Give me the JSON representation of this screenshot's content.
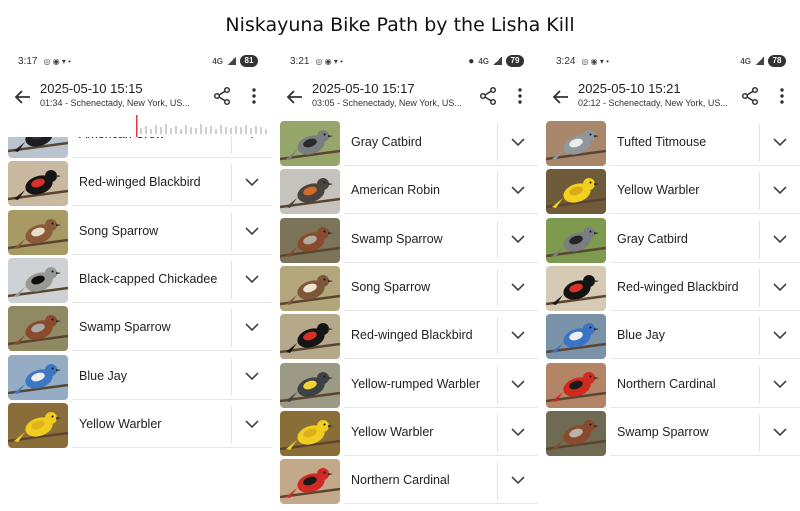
{
  "title": "Niskayuna Bike Path by the Lisha Kill",
  "screens": [
    {
      "status": {
        "time": "3:17",
        "network": "4G",
        "battery": "81"
      },
      "header": {
        "date": "2025-05-10 15:15",
        "sub": "01:34 - Schenectady, New York, US..."
      },
      "birds": [
        {
          "name": "American Crow",
          "icon": "american-crow-photo",
          "colors": [
            "#b9c4cf",
            "#1b1d22",
            "#2d3138"
          ]
        },
        {
          "name": "Red-winged Blackbird",
          "icon": "red-winged-blackbird-photo",
          "colors": [
            "#c8b9a0",
            "#151515",
            "#d8302a"
          ]
        },
        {
          "name": "Song Sparrow",
          "icon": "song-sparrow-photo",
          "colors": [
            "#a79a64",
            "#8b5a3a",
            "#e8ddc6"
          ]
        },
        {
          "name": "Black-capped Chickadee",
          "icon": "black-capped-chickadee-photo",
          "colors": [
            "#cfd2d4",
            "#9a9894",
            "#101010"
          ]
        },
        {
          "name": "Swamp Sparrow",
          "icon": "swamp-sparrow-photo",
          "colors": [
            "#8f8a63",
            "#8a4a2c",
            "#a8a8a8"
          ]
        },
        {
          "name": "Blue Jay",
          "icon": "blue-jay-photo",
          "colors": [
            "#95adc4",
            "#3d77c4",
            "#eceef0"
          ]
        },
        {
          "name": "Yellow Warbler",
          "icon": "yellow-warbler-photo",
          "colors": [
            "#8b6d3a",
            "#f0cc1e",
            "#e0b418"
          ]
        }
      ]
    },
    {
      "status": {
        "time": "3:21",
        "network": "4G",
        "battery": "79"
      },
      "header": {
        "date": "2025-05-10 15:17",
        "sub": "03:05 - Schenectady, New York, US..."
      },
      "birds": [
        {
          "name": "Gray Catbird",
          "icon": "gray-catbird-photo",
          "colors": [
            "#96a66a",
            "#7a7d80",
            "#2a2a2a"
          ]
        },
        {
          "name": "American Robin",
          "icon": "american-robin-photo",
          "colors": [
            "#c6c3bc",
            "#4a4440",
            "#d4692a"
          ]
        },
        {
          "name": "Swamp Sparrow",
          "icon": "swamp-sparrow-photo",
          "colors": [
            "#7b7458",
            "#8a4a2c",
            "#b0aca4"
          ]
        },
        {
          "name": "Song Sparrow",
          "icon": "song-sparrow-photo",
          "colors": [
            "#b3a67a",
            "#7e563a",
            "#eee3cc"
          ]
        },
        {
          "name": "Red-winged Blackbird",
          "icon": "red-winged-blackbird-photo",
          "colors": [
            "#b6a88a",
            "#141414",
            "#d62f26"
          ]
        },
        {
          "name": "Yellow-rumped Warbler",
          "icon": "yellow-rumped-warbler-photo",
          "colors": [
            "#9c9a84",
            "#3e4048",
            "#f1d330"
          ]
        },
        {
          "name": "Yellow Warbler",
          "icon": "yellow-warbler-photo",
          "colors": [
            "#8a6e38",
            "#f0cd20",
            "#dcb01a"
          ]
        },
        {
          "name": "Northern Cardinal",
          "icon": "northern-cardinal-photo",
          "colors": [
            "#c4a88a",
            "#cf2a24",
            "#1a1a1a"
          ]
        }
      ]
    },
    {
      "status": {
        "time": "3:24",
        "network": "4G",
        "battery": "78"
      },
      "header": {
        "date": "2025-05-10 15:21",
        "sub": "02:12 - Schenectady, New York, US..."
      },
      "birds": [
        {
          "name": "Tufted Titmouse",
          "icon": "tufted-titmouse-photo",
          "colors": [
            "#a8876a",
            "#8f969d",
            "#ecebe6"
          ]
        },
        {
          "name": "Yellow Warbler",
          "icon": "yellow-warbler-photo",
          "colors": [
            "#6f5a3a",
            "#f2d01e",
            "#d8ab18"
          ]
        },
        {
          "name": "Gray Catbird",
          "icon": "gray-catbird-photo",
          "colors": [
            "#7d9a4e",
            "#7a7e82",
            "#262626"
          ]
        },
        {
          "name": "Red-winged Blackbird",
          "icon": "red-winged-blackbird-photo",
          "colors": [
            "#d6cab4",
            "#131313",
            "#d8302a"
          ]
        },
        {
          "name": "Blue Jay",
          "icon": "blue-jay-photo",
          "colors": [
            "#7a93a8",
            "#3b74c6",
            "#eceef0"
          ]
        },
        {
          "name": "Northern Cardinal",
          "icon": "northern-cardinal-photo",
          "colors": [
            "#b48466",
            "#d1281f",
            "#1a1a1a"
          ]
        },
        {
          "name": "Swamp Sparrow",
          "icon": "swamp-sparrow-photo",
          "colors": [
            "#6f6a52",
            "#8a4a2c",
            "#b8b4ac"
          ]
        }
      ]
    }
  ]
}
